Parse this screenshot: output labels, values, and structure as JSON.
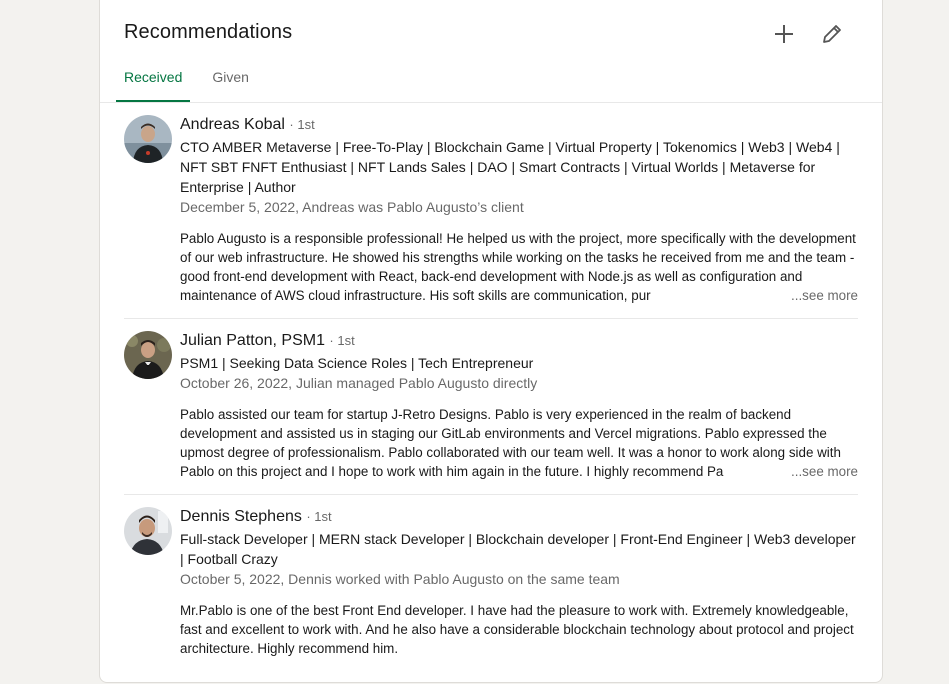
{
  "card": {
    "title": "Recommendations",
    "add_icon": "plus-icon",
    "edit_icon": "pencil-icon"
  },
  "tabs": [
    {
      "label": "Received",
      "active": true
    },
    {
      "label": "Given",
      "active": false
    }
  ],
  "colors": {
    "accent_green": "#057642"
  },
  "recommendations": [
    {
      "name": "Andreas Kobal",
      "degree": "· 1st",
      "headline": "CTO AMBER Metaverse | Free-To-Play | Blockchain Game | Virtual Property | Tokenomics | Web3 | Web4 | NFT SBT FNFT Enthusiast | NFT Lands Sales | DAO | Smart Contracts | Virtual Worlds | Metaverse for Enterprise | Author",
      "meta": "December 5, 2022, Andreas was Pablo Augusto’s client",
      "text": "Pablo Augusto is a responsible professional! He helped us with the project, more specifically with the development of our web infrastructure. He showed his strengths while working on the tasks he received from me and the team - good front-end development with React, back-end development with Node.js as well as configuration and maintenance of AWS cloud infrastructure. His soft skills are communication, pur",
      "see_more": "...see more"
    },
    {
      "name": "Julian Patton, PSM1",
      "degree": "· 1st",
      "headline": "PSM1 | Seeking Data Science Roles | Tech Entrepreneur",
      "meta": "October 26, 2022, Julian managed Pablo Augusto directly",
      "text": "Pablo assisted our team for startup J-Retro Designs. Pablo is very experienced in the realm of backend development and assisted us in staging our GitLab environments and Vercel migrations. Pablo expressed the upmost degree of professionalism. Pablo collaborated with our team well. It was a honor to work along side with Pablo on this project and I hope to work with him again in the future. I highly recommend Pa",
      "see_more": "...see more"
    },
    {
      "name": "Dennis Stephens",
      "degree": "· 1st",
      "headline": "Full-stack Developer | MERN stack Developer | Blockchain developer | Front-End Engineer | Web3 developer | Football Crazy",
      "meta": "October 5, 2022, Dennis worked with Pablo Augusto on the same team",
      "text": "Mr.Pablo is one of the best Front End developer. I have had the pleasure to work with. Extremely knowledgeable, fast and excellent to work with. And he also have a considerable blockchain technology about protocol and project architecture. Highly recommend him."
    }
  ]
}
